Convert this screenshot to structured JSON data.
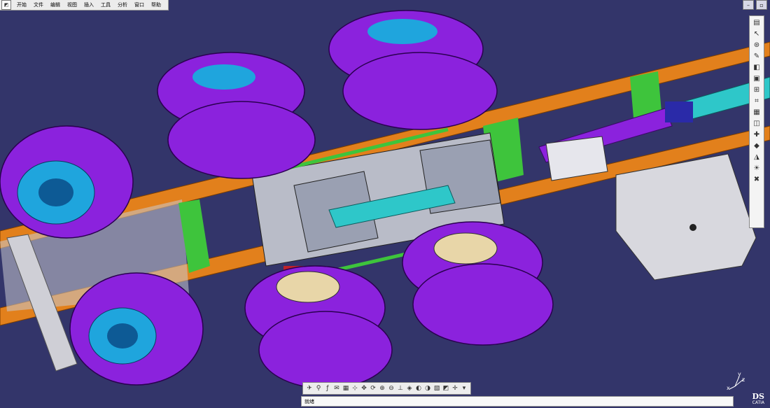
{
  "menu": [
    "开始",
    "文件",
    "编辑",
    "视图",
    "插入",
    "工具",
    "分析",
    "窗口",
    "帮助"
  ],
  "status": {
    "text": "就绪"
  },
  "compass": {
    "x": "x",
    "y": "y",
    "z": "z"
  },
  "logo": {
    "mark": "DS",
    "sub": "CATIA"
  },
  "colors": {
    "background": "#33356a",
    "tire": "#8b22dd",
    "frame": "#e2801c",
    "hub": "#1fa5dd",
    "green": "#3ec43c",
    "tank": "#d8d8de"
  },
  "right_toolbar_icons": [
    "document-icon",
    "select-arrow-icon",
    "fly-mode-icon",
    "sketch-icon",
    "part-icon",
    "assembly-icon",
    "constraint-icon",
    "measure-icon",
    "catalog-icon",
    "section-icon",
    "annotation-icon",
    "render-icon",
    "material-icon",
    "light-icon",
    "delete-icon"
  ],
  "bottom_toolbar_icons": [
    "fly-icon",
    "walk-icon",
    "formula-icon",
    "comment-icon",
    "view-grid-icon",
    "snap-icon",
    "pan-icon",
    "rotate-icon",
    "zoom-in-icon",
    "zoom-out-icon",
    "normal-view-icon",
    "iso-view-icon",
    "hide-show-icon",
    "swap-visible-icon",
    "render-style-icon",
    "shading-icon",
    "compass-icon",
    "save-icon"
  ]
}
